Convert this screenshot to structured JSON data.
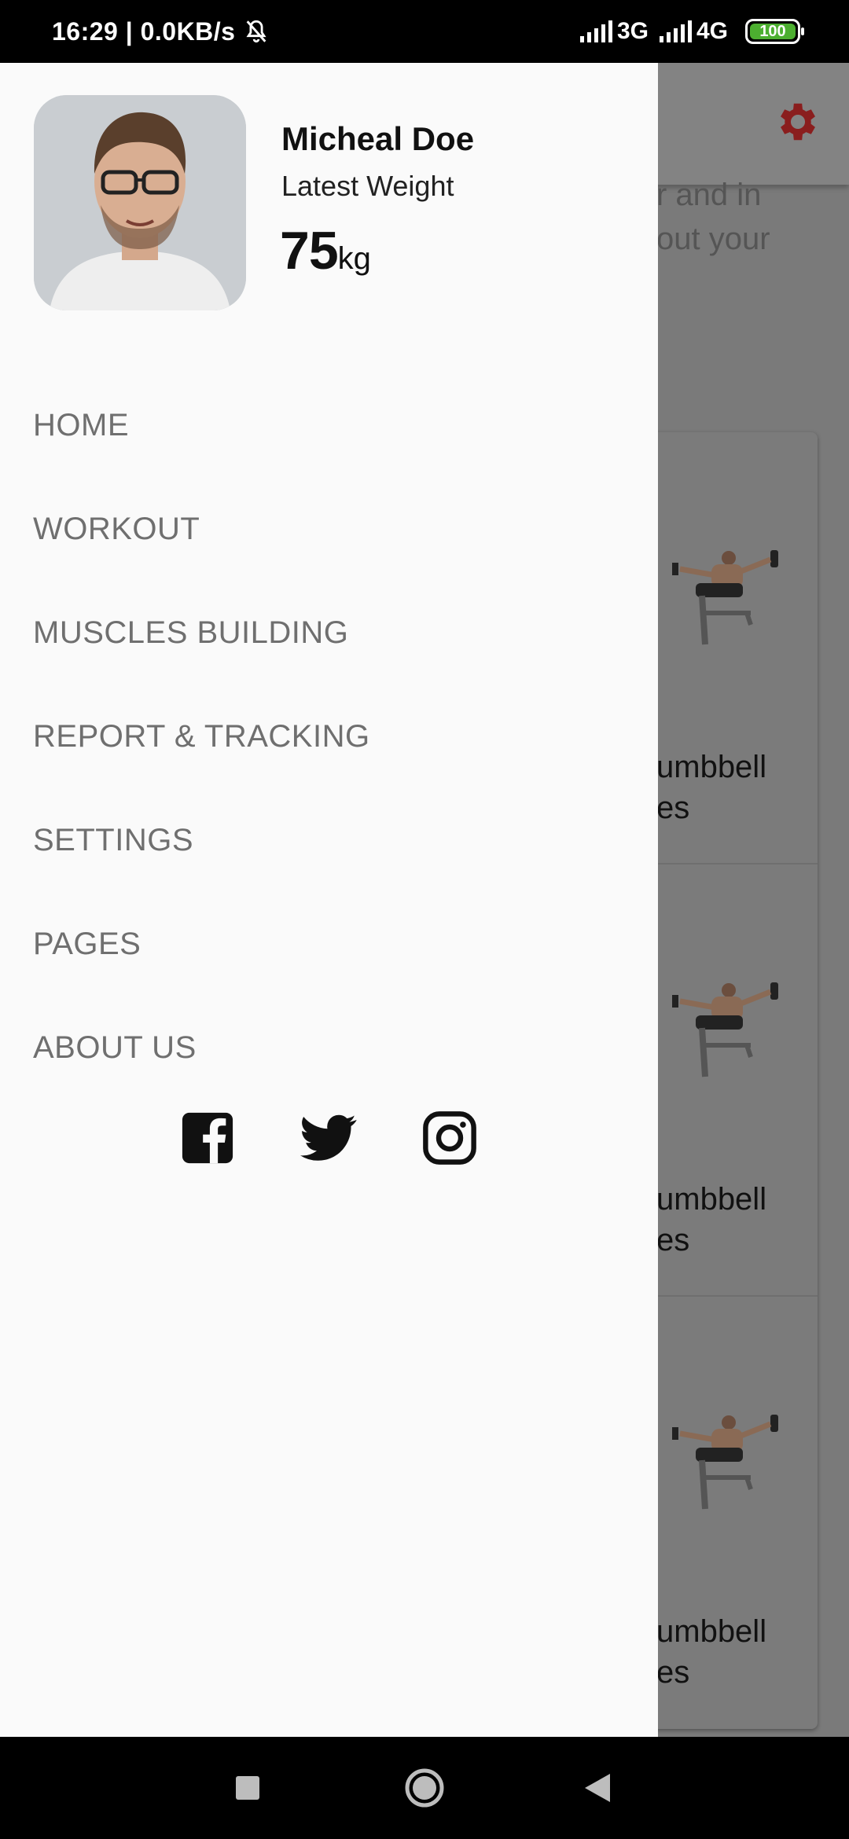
{
  "status_bar": {
    "time_speed": "16:29 | 0.0KB/s",
    "net1": "3G",
    "net2": "4G",
    "battery": "100"
  },
  "background": {
    "text_line1": "r and in",
    "text_line2": "out your",
    "card_label_line1": "umbbell",
    "card_label_line2": "es",
    "accent_color": "#c62828"
  },
  "drawer": {
    "profile": {
      "name": "Micheal Doe",
      "subtitle": "Latest Weight",
      "weight_value": "75",
      "weight_unit": "kg"
    },
    "menu": [
      {
        "label": "HOME"
      },
      {
        "label": "WORKOUT"
      },
      {
        "label": "MUSCLES BUILDING"
      },
      {
        "label": "REPORT & TRACKING"
      },
      {
        "label": "SETTINGS"
      },
      {
        "label": "PAGES"
      },
      {
        "label": "ABOUT US"
      }
    ],
    "social": [
      "facebook-icon",
      "twitter-icon",
      "instagram-icon"
    ]
  },
  "nav_bar": [
    "recents-square-icon",
    "home-circle-icon",
    "back-triangle-icon"
  ]
}
